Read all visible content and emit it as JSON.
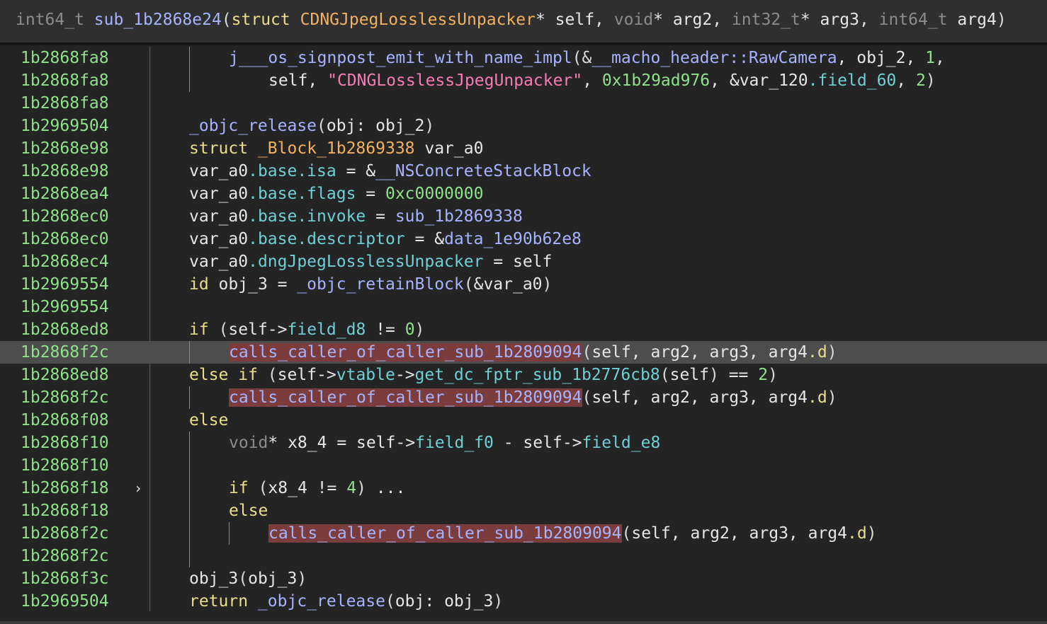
{
  "header": {
    "ret_type": "int64_t",
    "func_name": "sub_1b2868e24",
    "open": "(",
    "p1_kw": "struct",
    "p1_type": "CDNGJpegLosslessUnpacker",
    "p1_rest": "* self, ",
    "p2_type": "void",
    "p2_rest": "* arg2, ",
    "p3_type": "int32_t",
    "p3_rest": "* arg3, ",
    "p4_type": "int64_t",
    "p4_rest": " arg4",
    "close": ")"
  },
  "lines": [
    {
      "addr": "1b2868fa8",
      "t": [
        {
          "c": "f",
          "x": "j___os_signpost_emit_with_name_impl"
        },
        {
          "c": "p",
          "x": "(&"
        },
        {
          "c": "f",
          "x": "__macho_header::RawCamera"
        },
        {
          "c": "v",
          "x": ", obj_2, "
        },
        {
          "c": "n",
          "x": "1"
        },
        {
          "c": "v",
          "x": ","
        }
      ]
    },
    {
      "addr": "1b2868fa8",
      "t": [
        {
          "c": "v",
          "x": "self, "
        },
        {
          "c": "s",
          "x": "\"CDNGLosslessJpegUnpacker\""
        },
        {
          "c": "v",
          "x": ", "
        },
        {
          "c": "n",
          "x": "0x1b29ad976"
        },
        {
          "c": "v",
          "x": ", &var_120"
        },
        {
          "c": "fd",
          "x": ".field_60"
        },
        {
          "c": "v",
          "x": ", "
        },
        {
          "c": "n",
          "x": "2"
        },
        {
          "c": "p",
          "x": ")"
        }
      ]
    },
    {
      "addr": "1b2868fa8",
      "t": []
    },
    {
      "addr": "1b2969504",
      "t": [
        {
          "c": "f",
          "x": "_objc_release"
        },
        {
          "c": "p",
          "x": "("
        },
        {
          "c": "v",
          "x": "obj: obj_2"
        },
        {
          "c": "p",
          "x": ")"
        }
      ]
    },
    {
      "addr": "1b2868e98",
      "t": [
        {
          "c": "k",
          "x": "struct"
        },
        {
          "c": "v",
          "x": " "
        },
        {
          "c": "sty",
          "x": "_Block_1b2869338"
        },
        {
          "c": "v",
          "x": " var_a0"
        }
      ]
    },
    {
      "addr": "1b2868e98",
      "t": [
        {
          "c": "v",
          "x": "var_a0"
        },
        {
          "c": "fd",
          "x": ".base.isa"
        },
        {
          "c": "v",
          "x": " = &"
        },
        {
          "c": "f",
          "x": "__NSConcreteStackBlock"
        }
      ]
    },
    {
      "addr": "1b2868ea4",
      "t": [
        {
          "c": "v",
          "x": "var_a0"
        },
        {
          "c": "fd",
          "x": ".base.flags"
        },
        {
          "c": "v",
          "x": " = "
        },
        {
          "c": "n",
          "x": "0xc0000000"
        }
      ]
    },
    {
      "addr": "1b2868ec0",
      "t": [
        {
          "c": "v",
          "x": "var_a0"
        },
        {
          "c": "fd",
          "x": ".base.invoke"
        },
        {
          "c": "v",
          "x": " = "
        },
        {
          "c": "f",
          "x": "sub_1b2869338"
        }
      ]
    },
    {
      "addr": "1b2868ec0",
      "t": [
        {
          "c": "v",
          "x": "var_a0"
        },
        {
          "c": "fd",
          "x": ".base.descriptor"
        },
        {
          "c": "v",
          "x": " = &"
        },
        {
          "c": "f",
          "x": "data_1e90b62e8"
        }
      ]
    },
    {
      "addr": "1b2868ec4",
      "t": [
        {
          "c": "v",
          "x": "var_a0"
        },
        {
          "c": "fd",
          "x": ".dngJpegLosslessUnpacker"
        },
        {
          "c": "v",
          "x": " = self"
        }
      ]
    },
    {
      "addr": "1b2969554",
      "t": [
        {
          "c": "k",
          "x": "id"
        },
        {
          "c": "v",
          "x": " obj_3 = "
        },
        {
          "c": "f",
          "x": "_objc_retainBlock"
        },
        {
          "c": "p",
          "x": "("
        },
        {
          "c": "v",
          "x": "&var_a0"
        },
        {
          "c": "p",
          "x": ")"
        }
      ]
    },
    {
      "addr": "1b2969554",
      "t": []
    },
    {
      "addr": "1b2868ed8",
      "t": [
        {
          "c": "k",
          "x": "if"
        },
        {
          "c": "v",
          "x": " "
        },
        {
          "c": "p",
          "x": "("
        },
        {
          "c": "v",
          "x": "self->"
        },
        {
          "c": "fd",
          "x": "field_d8"
        },
        {
          "c": "v",
          "x": " != "
        },
        {
          "c": "n",
          "x": "0"
        },
        {
          "c": "p",
          "x": ")"
        }
      ]
    },
    {
      "addr": "1b2868f2c",
      "t": [
        {
          "c": "mark",
          "x": "calls_caller_of_caller_sub_1b2809094"
        },
        {
          "c": "p",
          "x": "("
        },
        {
          "c": "v",
          "x": "self, arg2, arg3, arg4"
        },
        {
          "c": "k",
          "x": ".d"
        },
        {
          "c": "p",
          "x": ")"
        }
      ]
    },
    {
      "addr": "1b2868ed8",
      "t": [
        {
          "c": "k",
          "x": "else if"
        },
        {
          "c": "v",
          "x": " "
        },
        {
          "c": "p",
          "x": "("
        },
        {
          "c": "v",
          "x": "self->"
        },
        {
          "c": "fd",
          "x": "vtable"
        },
        {
          "c": "v",
          "x": "->"
        },
        {
          "c": "fd",
          "x": "get_dc_fptr_sub_1b2776cb8"
        },
        {
          "c": "p",
          "x": "("
        },
        {
          "c": "v",
          "x": "self"
        },
        {
          "c": "p",
          "x": ")"
        },
        {
          "c": "v",
          "x": " == "
        },
        {
          "c": "n",
          "x": "2"
        },
        {
          "c": "p",
          "x": ")"
        }
      ]
    },
    {
      "addr": "1b2868f2c",
      "t": [
        {
          "c": "mark",
          "x": "calls_caller_of_caller_sub_1b2809094"
        },
        {
          "c": "p",
          "x": "("
        },
        {
          "c": "v",
          "x": "self, arg2, arg3, arg4"
        },
        {
          "c": "k",
          "x": ".d"
        },
        {
          "c": "p",
          "x": ")"
        }
      ]
    },
    {
      "addr": "1b2868f08",
      "t": [
        {
          "c": "k",
          "x": "else"
        }
      ]
    },
    {
      "addr": "1b2868f10",
      "t": [
        {
          "c": "ty",
          "x": "void"
        },
        {
          "c": "v",
          "x": "* x8_4 = self->"
        },
        {
          "c": "fd",
          "x": "field_f0"
        },
        {
          "c": "v",
          "x": " - self->"
        },
        {
          "c": "fd",
          "x": "field_e8"
        }
      ]
    },
    {
      "addr": "1b2868f10",
      "t": []
    },
    {
      "addr": "1b2868f18",
      "t": [
        {
          "c": "k",
          "x": "if"
        },
        {
          "c": "v",
          "x": " "
        },
        {
          "c": "p",
          "x": "("
        },
        {
          "c": "v",
          "x": "x8_4 != "
        },
        {
          "c": "n",
          "x": "4"
        },
        {
          "c": "p",
          "x": ")"
        },
        {
          "c": "v",
          "x": " ..."
        }
      ]
    },
    {
      "addr": "1b2868f18",
      "t": [
        {
          "c": "k",
          "x": "else"
        }
      ]
    },
    {
      "addr": "1b2868f2c",
      "t": [
        {
          "c": "mark",
          "x": "calls_caller_of_caller_sub_1b2809094"
        },
        {
          "c": "p",
          "x": "("
        },
        {
          "c": "v",
          "x": "self, arg2, arg3, arg4"
        },
        {
          "c": "k",
          "x": ".d"
        },
        {
          "c": "p",
          "x": ")"
        }
      ]
    },
    {
      "addr": "1b2868f2c",
      "t": []
    },
    {
      "addr": "1b2868f3c",
      "t": [
        {
          "c": "v",
          "x": "obj_3"
        },
        {
          "c": "p",
          "x": "("
        },
        {
          "c": "v",
          "x": "obj_3"
        },
        {
          "c": "p",
          "x": ")"
        }
      ]
    },
    {
      "addr": "1b2969504",
      "t": [
        {
          "c": "k",
          "x": "return"
        },
        {
          "c": "v",
          "x": " "
        },
        {
          "c": "f",
          "x": "_objc_release"
        },
        {
          "c": "p",
          "x": "("
        },
        {
          "c": "v",
          "x": "obj: obj_3"
        },
        {
          "c": "p",
          "x": ")"
        }
      ]
    }
  ],
  "collapse_icon": "chevron-right-icon",
  "collapse_glyph": "›"
}
